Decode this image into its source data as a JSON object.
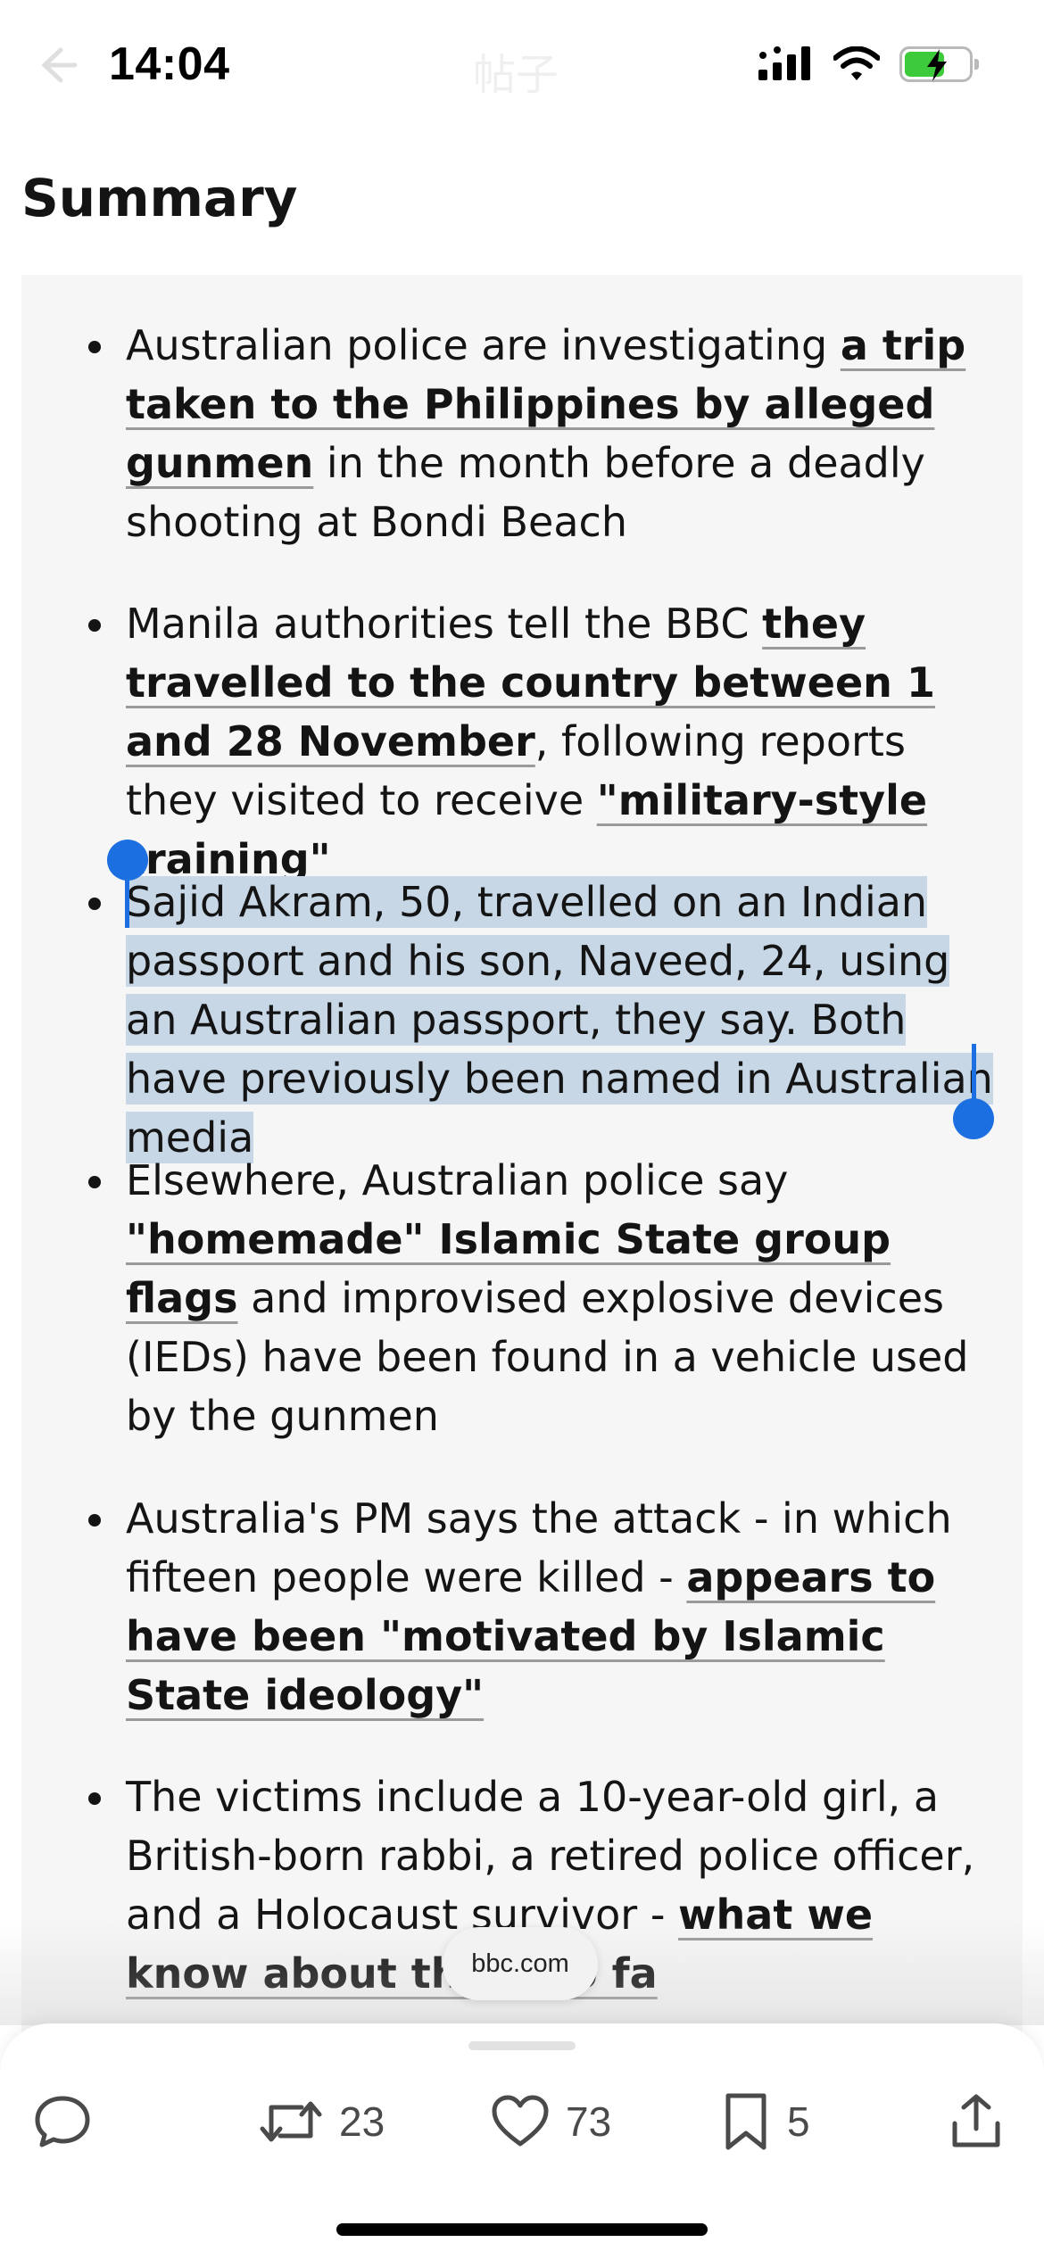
{
  "status_bar": {
    "time": "14:04",
    "ghost_title": "帖子"
  },
  "article": {
    "heading": "Summary",
    "bullets": [
      {
        "t1": "Australian police are investigating ",
        "l1": "a trip taken to the Philippines by alleged gunmen",
        "t2": " in the month before a deadly shooting at Bondi Beach"
      },
      {
        "t1": "Manila authorities tell the BBC ",
        "l1": "they travelled to the country between 1 and 28 November",
        "t2": ", following reports they visited to receive ",
        "l2": "\"military-style training\""
      },
      {
        "selected": "Sajid Akram, 50, travelled on an Indian passport and his son, Naveed, 24, using an Australian passport, they say. Both have previously been named in Australian media"
      },
      {
        "t1": "Elsewhere, Australian police say ",
        "l1": "\"homemade\" Islamic State group flags",
        "t2": " and improvised explosive devices (IEDs) have been found in a vehicle used by the gunmen"
      },
      {
        "t1": "Australia's PM says the attack - in which fifteen people were killed - ",
        "l1": "appears to have been \"motivated by Islamic State ideology\""
      },
      {
        "t1": "The victims include a 10-year-old girl, a British-born rabbi, a retired police officer, and a Holocaust survivor - ",
        "l1": "what we know about them so fa"
      }
    ]
  },
  "source_pill": "bbc.com",
  "actions": {
    "comment_icon": "speech-bubble-icon",
    "repost_count": "23",
    "like_count": "73",
    "bookmark_count": "5",
    "share_icon": "share-icon"
  },
  "colors": {
    "selection": "#c7d7e6",
    "handle": "#1c6fe0",
    "summary_bg": "#f6f6f6",
    "battery": "#3ecb3b"
  }
}
